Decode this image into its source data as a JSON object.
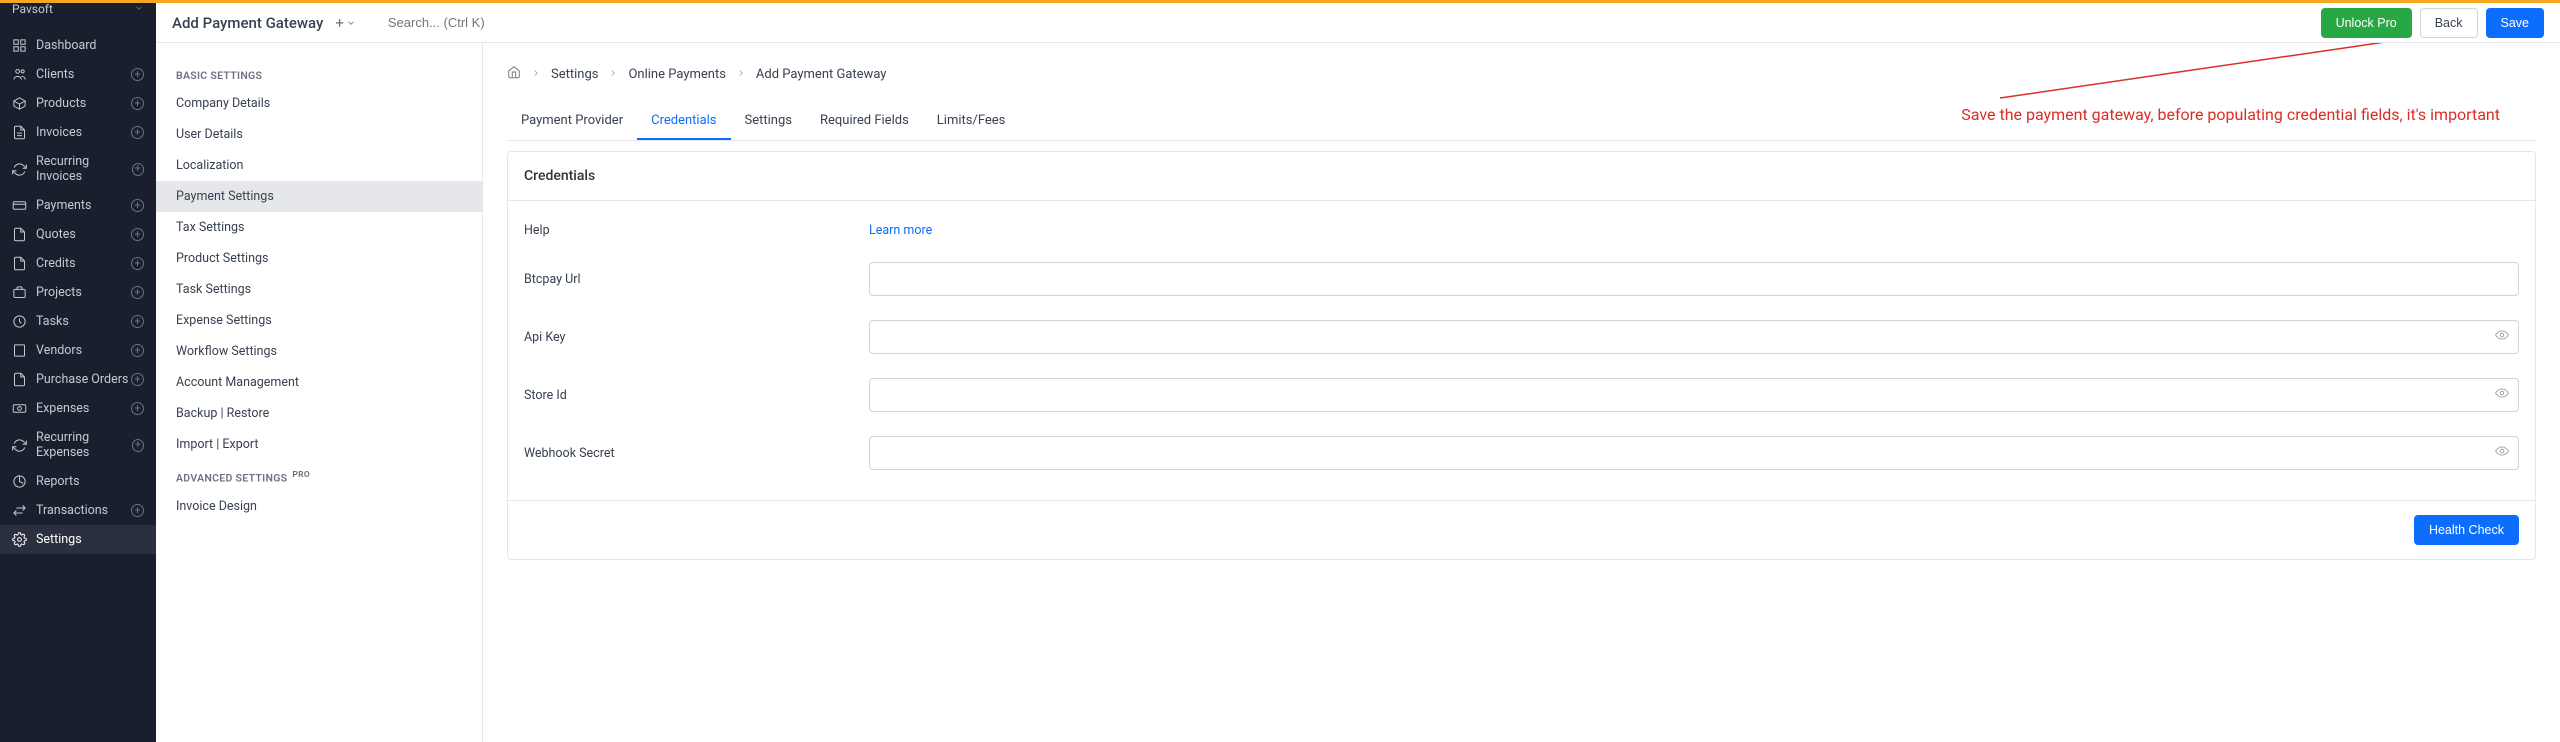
{
  "workspace": {
    "name": "Pavsoft"
  },
  "nav": {
    "items": [
      {
        "label": "Dashboard",
        "icon": "dashboard",
        "plus": false
      },
      {
        "label": "Clients",
        "icon": "clients",
        "plus": true
      },
      {
        "label": "Products",
        "icon": "products",
        "plus": true
      },
      {
        "label": "Invoices",
        "icon": "invoices",
        "plus": true
      },
      {
        "label": "Recurring Invoices",
        "icon": "recurring",
        "plus": true
      },
      {
        "label": "Payments",
        "icon": "payments",
        "plus": true
      },
      {
        "label": "Quotes",
        "icon": "quotes",
        "plus": true
      },
      {
        "label": "Credits",
        "icon": "credits",
        "plus": true
      },
      {
        "label": "Projects",
        "icon": "projects",
        "plus": true
      },
      {
        "label": "Tasks",
        "icon": "tasks",
        "plus": true
      },
      {
        "label": "Vendors",
        "icon": "vendors",
        "plus": true
      },
      {
        "label": "Purchase Orders",
        "icon": "purchase",
        "plus": true
      },
      {
        "label": "Expenses",
        "icon": "expenses",
        "plus": true
      },
      {
        "label": "Recurring Expenses",
        "icon": "recurring",
        "plus": true
      },
      {
        "label": "Reports",
        "icon": "reports",
        "plus": false
      },
      {
        "label": "Transactions",
        "icon": "transactions",
        "plus": true
      },
      {
        "label": "Settings",
        "icon": "settings",
        "plus": false,
        "active": true
      }
    ]
  },
  "header": {
    "title": "Add Payment Gateway",
    "search_placeholder": "Search... (Ctrl K)",
    "unlock": "Unlock Pro",
    "back": "Back",
    "save": "Save"
  },
  "settings_sidebar": {
    "basic_title": "BASIC SETTINGS",
    "basic_items": [
      "Company Details",
      "User Details",
      "Localization",
      "Payment Settings",
      "Tax Settings",
      "Product Settings",
      "Task Settings",
      "Expense Settings",
      "Workflow Settings",
      "Account Management",
      "Backup | Restore",
      "Import | Export"
    ],
    "advanced_title": "ADVANCED SETTINGS",
    "pro": "PRO",
    "advanced_items": [
      "Invoice Design"
    ]
  },
  "breadcrumb": {
    "items": [
      "Settings",
      "Online Payments",
      "Add Payment Gateway"
    ]
  },
  "tabs": {
    "items": [
      "Payment Provider",
      "Credentials",
      "Settings",
      "Required Fields",
      "Limits/Fees"
    ],
    "active": 1
  },
  "annotation": "Save the payment gateway, before populating credential fields, it's important",
  "panel": {
    "title": "Credentials",
    "help_label": "Help",
    "help_link": "Learn more",
    "fields": [
      {
        "label": "Btcpay Url",
        "eye": false
      },
      {
        "label": "Api Key",
        "eye": true
      },
      {
        "label": "Store Id",
        "eye": true
      },
      {
        "label": "Webhook Secret",
        "eye": true
      }
    ],
    "health_check": "Health Check"
  }
}
